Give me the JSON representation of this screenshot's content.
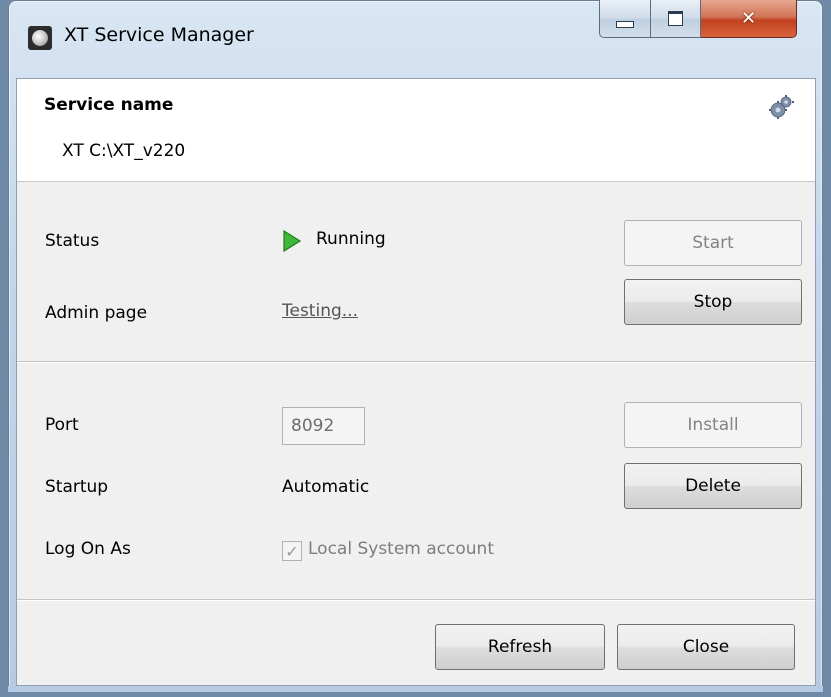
{
  "window": {
    "title": "XT Service Manager",
    "close_glyph": "✕"
  },
  "header": {
    "service_name_label": "Service name",
    "service_name_value": "XT C:\\XT_v220",
    "settings_icon": "gears-icon"
  },
  "status_section": {
    "status_label": "Status",
    "status_value": "Running",
    "status_icon": "play-icon",
    "status_color": "#3db83a",
    "admin_label": "Admin page",
    "admin_link_text": "Testing...",
    "start_button": "Start",
    "stop_button": "Stop"
  },
  "config_section": {
    "port_label": "Port",
    "port_value": "8092",
    "startup_label": "Startup",
    "startup_value": "Automatic",
    "logon_label": "Log On As",
    "logon_checkbox_label": "Local System account",
    "logon_checked": true,
    "install_button": "Install",
    "delete_button": "Delete"
  },
  "footer": {
    "refresh_button": "Refresh",
    "close_button": "Close"
  }
}
